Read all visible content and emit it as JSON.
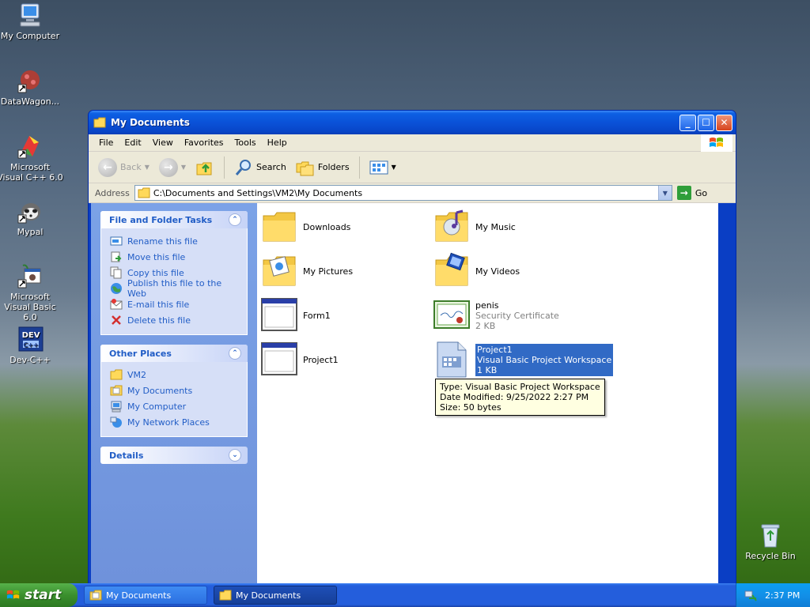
{
  "desktop": {
    "icons": [
      {
        "label": "My Computer"
      },
      {
        "label": "DataWagon..."
      },
      {
        "label": "Microsoft Visual C++ 6.0"
      },
      {
        "label": "Mypal"
      },
      {
        "label": "Microsoft Visual Basic 6.0"
      },
      {
        "label": "Dev-C++"
      },
      {
        "label": "Recycle Bin"
      }
    ]
  },
  "window": {
    "title": "My Documents",
    "menu": [
      "File",
      "Edit",
      "View",
      "Favorites",
      "Tools",
      "Help"
    ],
    "toolbar": {
      "back": "Back",
      "search": "Search",
      "folders": "Folders"
    },
    "address": {
      "label": "Address",
      "value": "C:\\Documents and Settings\\VM2\\My Documents",
      "go": "Go"
    },
    "tasks": {
      "file_folder_header": "File and Folder Tasks",
      "file_folder_items": [
        "Rename this file",
        "Move this file",
        "Copy this file",
        "Publish this file to the Web",
        "E-mail this file",
        "Delete this file"
      ],
      "other_places_header": "Other Places",
      "other_places_items": [
        "VM2",
        "My Documents",
        "My Computer",
        "My Network Places"
      ],
      "details_header": "Details"
    },
    "files": [
      {
        "name": "Downloads"
      },
      {
        "name": "My Music"
      },
      {
        "name": "My Pictures"
      },
      {
        "name": "My Videos"
      },
      {
        "name": "Form1"
      },
      {
        "name": "penis",
        "type": "Security Certificate",
        "size": "2 KB"
      },
      {
        "name": "Project1"
      },
      {
        "name": "Project1",
        "type": "Visual Basic Project Workspace",
        "size": "1 KB"
      }
    ],
    "tooltip": {
      "line1": "Type: Visual Basic Project Workspace",
      "line2": "Date Modified: 9/25/2022 2:27 PM",
      "line3": "Size: 50 bytes"
    }
  },
  "taskbar": {
    "start": "start",
    "tasks": [
      "My Documents",
      "My Documents"
    ],
    "clock": "2:37 PM"
  }
}
